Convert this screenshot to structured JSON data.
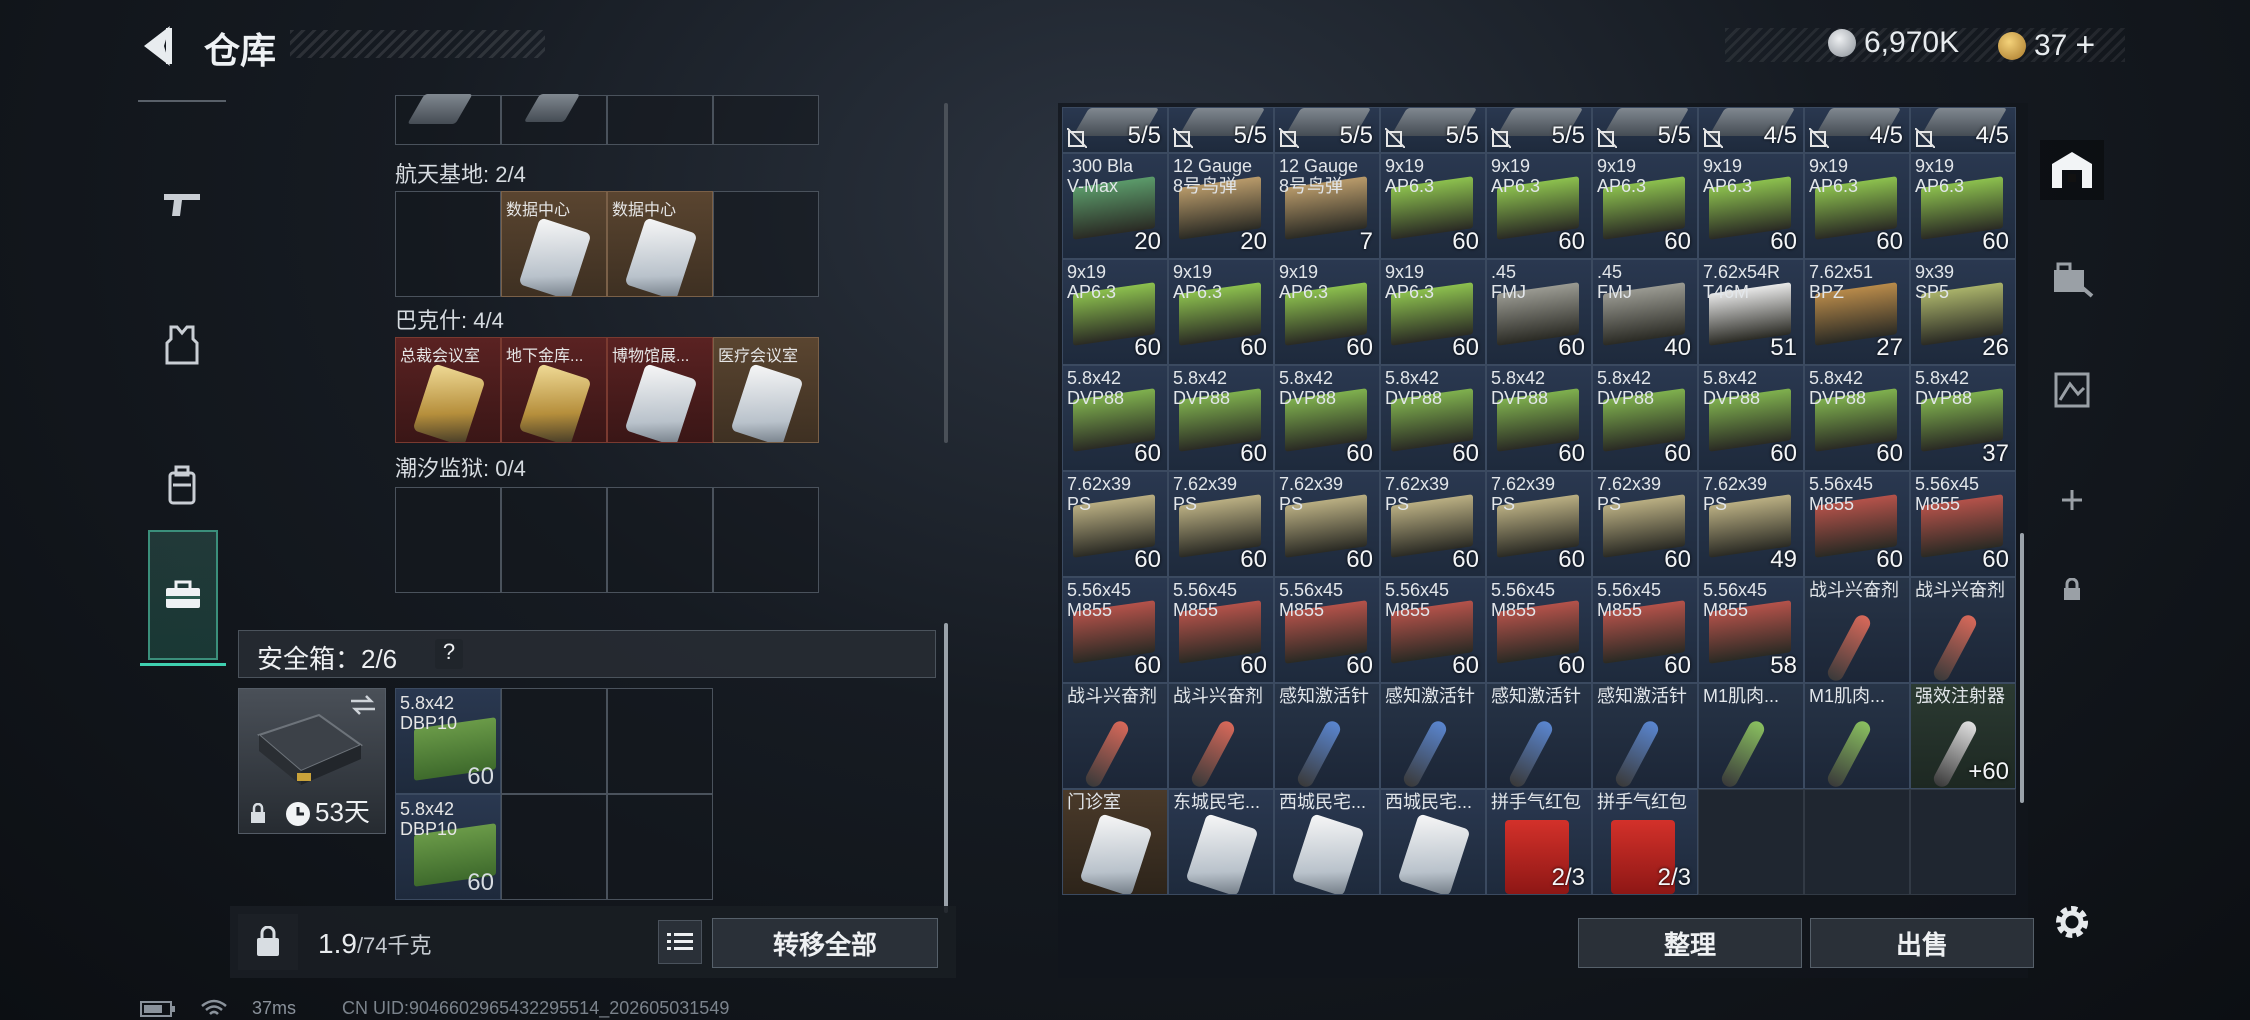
{
  "header": {
    "title": "仓库",
    "currency_amount": "6,970K",
    "token_amount": "37",
    "add_label": "+"
  },
  "nav": {
    "items": [
      "weapons",
      "gear",
      "backpack",
      "safebox"
    ]
  },
  "left": {
    "sections": [
      {
        "label": "航天基地: 2/4",
        "cells": [
          {
            "name": "",
            "type": "empty"
          },
          {
            "name": "数据中心",
            "type": "white"
          },
          {
            "name": "数据中心",
            "type": "white"
          },
          {
            "name": "",
            "type": "empty"
          }
        ]
      },
      {
        "label": "巴克什: 4/4",
        "cells": [
          {
            "name": "总裁会议室",
            "type": "gold-red"
          },
          {
            "name": "地下金库...",
            "type": "gold-red"
          },
          {
            "name": "博物馆展...",
            "type": "white-red"
          },
          {
            "name": "医疗会议室",
            "type": "white-brown"
          }
        ]
      },
      {
        "label": "潮汐监狱: 0/4",
        "cells": []
      }
    ],
    "safebox_label": "安全箱：2/6",
    "safebox_help": "?",
    "safebox_days": "53天",
    "safebox_items": [
      {
        "name": "5.8x42\nDBP10",
        "count": "60"
      },
      {
        "name": "5.8x42\nDBP10",
        "count": "60"
      }
    ],
    "weight": "1.9",
    "weight_cap": "/74千克",
    "transfer_label": "转移全部"
  },
  "right": {
    "row0": [
      {
        "count": "5/5"
      },
      {
        "count": "5/5"
      },
      {
        "count": "5/5"
      },
      {
        "count": "5/5"
      },
      {
        "count": "5/5"
      },
      {
        "count": "5/5"
      },
      {
        "count": "4/5"
      },
      {
        "count": "4/5"
      },
      {
        "count": "4/5"
      }
    ],
    "rows": [
      [
        {
          "name": ".300 Bla\nV-Max",
          "count": "20",
          "color": "#5b9a6a"
        },
        {
          "name": "12 Gauge\n8号鸟弹",
          "count": "20",
          "color": "#b89a6a"
        },
        {
          "name": "12 Gauge\n8号鸟弹",
          "count": "7",
          "color": "#b89a6a"
        },
        {
          "name": "9x19\nAP6.3",
          "count": "60",
          "color": "#8cc04e"
        },
        {
          "name": "9x19\nAP6.3",
          "count": "60",
          "color": "#8cc04e"
        },
        {
          "name": "9x19\nAP6.3",
          "count": "60",
          "color": "#8cc04e"
        },
        {
          "name": "9x19\nAP6.3",
          "count": "60",
          "color": "#8cc04e"
        },
        {
          "name": "9x19\nAP6.3",
          "count": "60",
          "color": "#8cc04e"
        },
        {
          "name": "9x19\nAP6.3",
          "count": "60",
          "color": "#8cc04e"
        }
      ],
      [
        {
          "name": "9x19\nAP6.3",
          "count": "60",
          "color": "#8cc04e"
        },
        {
          "name": "9x19\nAP6.3",
          "count": "60",
          "color": "#8cc04e"
        },
        {
          "name": "9x19\nAP6.3",
          "count": "60",
          "color": "#8cc04e"
        },
        {
          "name": "9x19\nAP6.3",
          "count": "60",
          "color": "#8cc04e"
        },
        {
          "name": ".45\nFMJ",
          "count": "60",
          "color": "#9a9a92"
        },
        {
          "name": ".45\nFMJ",
          "count": "40",
          "color": "#9a9a92"
        },
        {
          "name": "7.62x54R\nT46M",
          "count": "51",
          "color": "#e8e8e8"
        },
        {
          "name": "7.62x51\nBPZ",
          "count": "27",
          "color": "#b88a4a"
        },
        {
          "name": "9x39\nSP5",
          "count": "26",
          "color": "#a9b26a"
        }
      ],
      [
        {
          "name": "5.8x42\nDVP88",
          "count": "60",
          "color": "#7fb04e"
        },
        {
          "name": "5.8x42\nDVP88",
          "count": "60",
          "color": "#7fb04e"
        },
        {
          "name": "5.8x42\nDVP88",
          "count": "60",
          "color": "#7fb04e"
        },
        {
          "name": "5.8x42\nDVP88",
          "count": "60",
          "color": "#7fb04e"
        },
        {
          "name": "5.8x42\nDVP88",
          "count": "60",
          "color": "#7fb04e"
        },
        {
          "name": "5.8x42\nDVP88",
          "count": "60",
          "color": "#7fb04e"
        },
        {
          "name": "5.8x42\nDVP88",
          "count": "60",
          "color": "#7fb04e"
        },
        {
          "name": "5.8x42\nDVP88",
          "count": "60",
          "color": "#7fb04e"
        },
        {
          "name": "5.8x42\nDVP88",
          "count": "37",
          "color": "#7fb04e"
        }
      ],
      [
        {
          "name": "7.62x39\nPS",
          "count": "60",
          "color": "#b9ae82"
        },
        {
          "name": "7.62x39\nPS",
          "count": "60",
          "color": "#b9ae82"
        },
        {
          "name": "7.62x39\nPS",
          "count": "60",
          "color": "#b9ae82"
        },
        {
          "name": "7.62x39\nPS",
          "count": "60",
          "color": "#b9ae82"
        },
        {
          "name": "7.62x39\nPS",
          "count": "60",
          "color": "#b9ae82"
        },
        {
          "name": "7.62x39\nPS",
          "count": "60",
          "color": "#b9ae82"
        },
        {
          "name": "7.62x39\nPS",
          "count": "49",
          "color": "#b9ae82"
        },
        {
          "name": "5.56x45\nM855",
          "count": "60",
          "color": "#b4524a"
        },
        {
          "name": "5.56x45\nM855",
          "count": "60",
          "color": "#b4524a"
        }
      ],
      [
        {
          "name": "5.56x45\nM855",
          "count": "60",
          "color": "#b4524a"
        },
        {
          "name": "5.56x45\nM855",
          "count": "60",
          "color": "#b4524a"
        },
        {
          "name": "5.56x45\nM855",
          "count": "60",
          "color": "#b4524a"
        },
        {
          "name": "5.56x45\nM855",
          "count": "60",
          "color": "#b4524a"
        },
        {
          "name": "5.56x45\nM855",
          "count": "60",
          "color": "#b4524a"
        },
        {
          "name": "5.56x45\nM855",
          "count": "60",
          "color": "#b4524a"
        },
        {
          "name": "5.56x45\nM855",
          "count": "58",
          "color": "#b4524a"
        },
        {
          "name": "战斗兴奋剂",
          "count": "",
          "color": "#d8695a",
          "kind": "stim"
        },
        {
          "name": "战斗兴奋剂",
          "count": "",
          "color": "#d8695a",
          "kind": "stim"
        }
      ],
      [
        {
          "name": "战斗兴奋剂",
          "count": "",
          "color": "#d8695a",
          "kind": "stim"
        },
        {
          "name": "战斗兴奋剂",
          "count": "",
          "color": "#d8695a",
          "kind": "stim"
        },
        {
          "name": "感知激活针",
          "count": "",
          "color": "#5a86d0",
          "kind": "stim"
        },
        {
          "name": "感知激活针",
          "count": "",
          "color": "#5a86d0",
          "kind": "stim"
        },
        {
          "name": "感知激活针",
          "count": "",
          "color": "#5a86d0",
          "kind": "stim"
        },
        {
          "name": "感知激活针",
          "count": "",
          "color": "#5a86d0",
          "kind": "stim"
        },
        {
          "name": "M1肌肉...",
          "count": "",
          "color": "#8ac060",
          "kind": "stim"
        },
        {
          "name": "M1肌肉...",
          "count": "",
          "color": "#8ac060",
          "kind": "stim"
        },
        {
          "name": "强效注射器",
          "count": "60",
          "color": "#e0e0e0",
          "kind": "stim-green",
          "plus": "+"
        }
      ],
      [
        {
          "name": "门诊室",
          "count": "",
          "kind": "card-brown"
        },
        {
          "name": "东城民宅...",
          "count": "",
          "kind": "card"
        },
        {
          "name": "西城民宅...",
          "count": "",
          "kind": "card"
        },
        {
          "name": "西城民宅...",
          "count": "",
          "kind": "card"
        },
        {
          "name": "拼手气红包",
          "count": "2/3",
          "kind": "red"
        },
        {
          "name": "拼手气红包",
          "count": "2/3",
          "kind": "red"
        },
        {
          "name": "",
          "count": "",
          "kind": "plain"
        },
        {
          "name": "",
          "count": "",
          "kind": "plain"
        },
        {
          "name": "",
          "count": "",
          "kind": "plain"
        }
      ]
    ],
    "sort_label": "整理",
    "sell_label": "出售"
  },
  "status": {
    "ping": "37ms",
    "uid": "CN UID:9046602965432295514_202605031549"
  }
}
